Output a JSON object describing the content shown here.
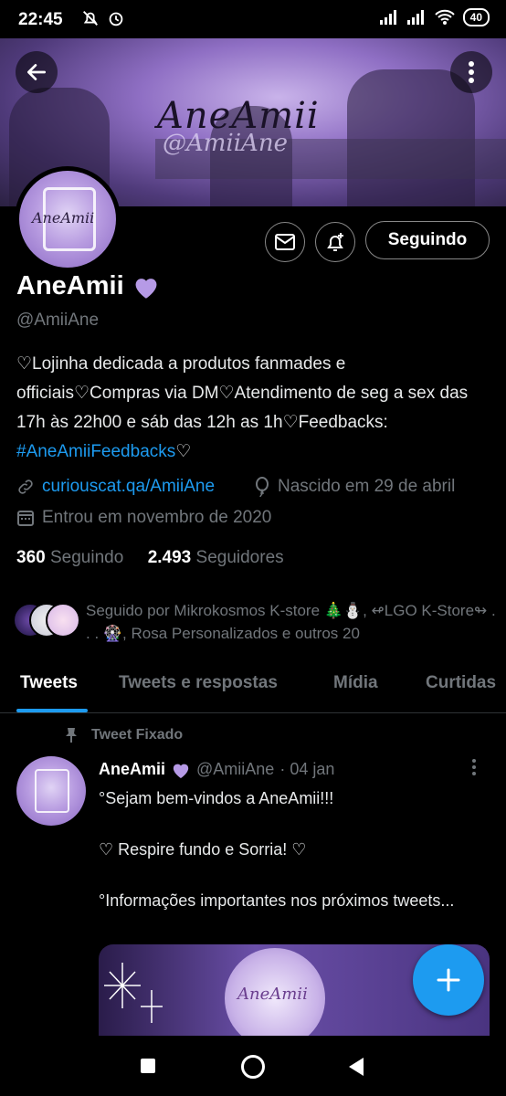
{
  "status_bar": {
    "time": "22:45",
    "battery": "40"
  },
  "banner": {
    "logo_text": "AneAmii",
    "logo_sub": "@AmiiAne"
  },
  "avatar": {
    "logo_text": "AneAmii"
  },
  "actions": {
    "follow_label": "Seguindo"
  },
  "profile": {
    "name": "AneAmii",
    "handle": "@AmiiAne",
    "bio_text": "♡Lojinha dedicada a produtos fanmades e officiais♡Compras via DM♡Atendimento de seg a sex das 17h às 22h00 e sáb das 12h as 1h♡Feedbacks: ",
    "bio_tag": "#AneAmiiFeedbacks",
    "bio_end": "♡",
    "link": "curiouscat.qa/AmiiAne",
    "birthday": "Nascido em 29 de abril",
    "joined": "Entrou em novembro de 2020",
    "following_count": "360",
    "following_label": "Seguindo",
    "followers_count": "2.493",
    "followers_label": "Seguidores",
    "followed_by": "Seguido por Mikrokosmos K-store 🎄⛄, ↫LGO K-Store↬ . . . 🎡, Rosa Personalizados e outros 20"
  },
  "tabs": [
    "Tweets",
    "Tweets e respostas",
    "Mídia",
    "Curtidas"
  ],
  "pinned_tweet": {
    "pinned_label": "Tweet Fixado",
    "author": "AneAmii",
    "handle": "@AmiiAne",
    "date": "· 04 jan",
    "text": "°Sejam bem-vindos a AneAmii!!!\n\n     ♡ Respire fundo e Sorria! ♡\n\n°Informações importantes nos próximos tweets...",
    "media_logo": "AneAmii"
  },
  "colors": {
    "accent": "#1d9bf0",
    "heart": "#b69ae6",
    "background": "#000000"
  }
}
